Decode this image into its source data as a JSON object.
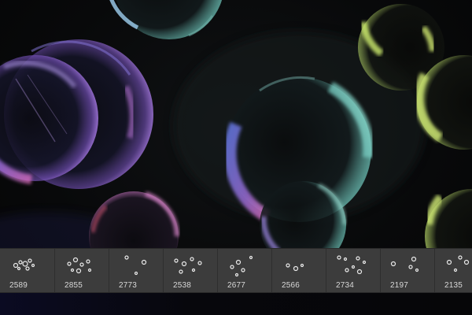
{
  "brushes": [
    {
      "label": "2589"
    },
    {
      "label": "2855"
    },
    {
      "label": "2773"
    },
    {
      "label": "2538"
    },
    {
      "label": "2677"
    },
    {
      "label": "2566"
    },
    {
      "label": "2734"
    },
    {
      "label": "2197"
    },
    {
      "label": "2135"
    }
  ],
  "colors": {
    "bubble_violet": "#a070e0",
    "bubble_cyan": "#7fd6c8",
    "bubble_lime": "#c8e070",
    "bubble_pink": "#e070c0",
    "strip_bg": "#3a3a3a"
  },
  "icons": {
    "bubble_brush_thumbnail": "bubble-cluster-icon"
  }
}
